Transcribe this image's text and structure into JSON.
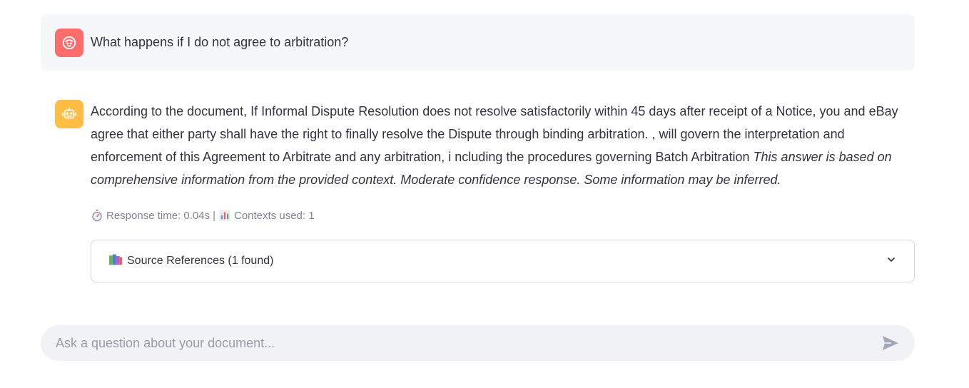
{
  "user_message": {
    "avatar_icon": "user-face-icon",
    "text": "What happens if I do not agree to arbitration?"
  },
  "assistant_message": {
    "avatar_icon": "robot-icon",
    "answer_main": "According to the document, If Informal Dispute Resolution does not resolve satisfactorily within 45 days after receipt of a Notice, you and eBay agree that either party shall have the right to finally resolve the Dispute through binding arbitration. , will govern the interpretation and enforcement of this Agreement to Arbitrate and any arbitration, i ncluding the procedures governing Batch Arbitration ",
    "answer_italic": "This answer is based on comprehensive information from the provided context. Moderate confidence response. Some information may be inferred.",
    "meta": {
      "response_time": "Response time: 0.04s",
      "separator": "|",
      "contexts_used": "Contexts used: 1"
    },
    "expander": {
      "label": "Source References (1 found)",
      "icon": "books-icon"
    }
  },
  "chat_input": {
    "placeholder": "Ask a question about your document...",
    "value": ""
  },
  "colors": {
    "user_avatar": "#ff6c6c",
    "bot_avatar": "#ffbd45",
    "user_bg": "#f6f7f9",
    "input_bg": "#f0f2f6"
  }
}
